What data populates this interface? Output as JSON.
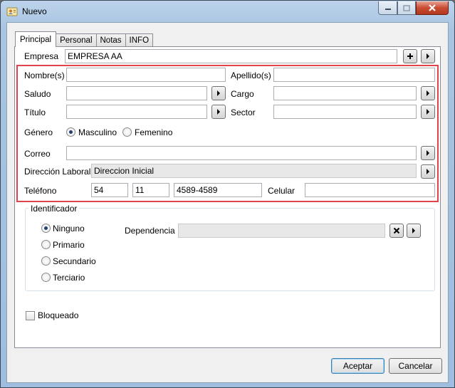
{
  "window": {
    "title": "Nuevo"
  },
  "tabs": [
    {
      "label": "Principal",
      "active": true
    },
    {
      "label": "Personal",
      "active": false
    },
    {
      "label": "Notas",
      "active": false
    },
    {
      "label": "INFO",
      "active": false
    }
  ],
  "form": {
    "empresa_label": "Empresa",
    "empresa_value": "EMPRESA AA",
    "nombre_label": "Nombre(s)",
    "nombre_value": "",
    "apellido_label": "Apellido(s)",
    "apellido_value": "",
    "saludo_label": "Saludo",
    "saludo_value": "",
    "cargo_label": "Cargo",
    "cargo_value": "",
    "titulo_label": "Título",
    "titulo_value": "",
    "sector_label": "Sector",
    "sector_value": "",
    "genero_label": "Género",
    "genero_options": [
      "Masculino",
      "Femenino"
    ],
    "genero_selected": "Masculino",
    "correo_label": "Correo",
    "correo_value": "",
    "direccion_label": "Dirección Laboral",
    "direccion_value": "Direccion Inicial",
    "telefono_label": "Teléfono",
    "telefono_country": "54",
    "telefono_area": "11",
    "telefono_number": "4589-4589",
    "celular_label": "Celular",
    "celular_value": ""
  },
  "identificador": {
    "title": "Identificador",
    "options": [
      "Ninguno",
      "Primario",
      "Secundario",
      "Terciario"
    ],
    "selected": "Ninguno",
    "dependencia_label": "Dependencia",
    "dependencia_value": ""
  },
  "bloqueado_label": "Bloqueado",
  "bloqueado_checked": false,
  "buttons": {
    "accept": "Aceptar",
    "cancel": "Cancelar"
  },
  "colors": {
    "highlight_box": "#e0434b",
    "default_button_border": "#3c7fb1"
  }
}
